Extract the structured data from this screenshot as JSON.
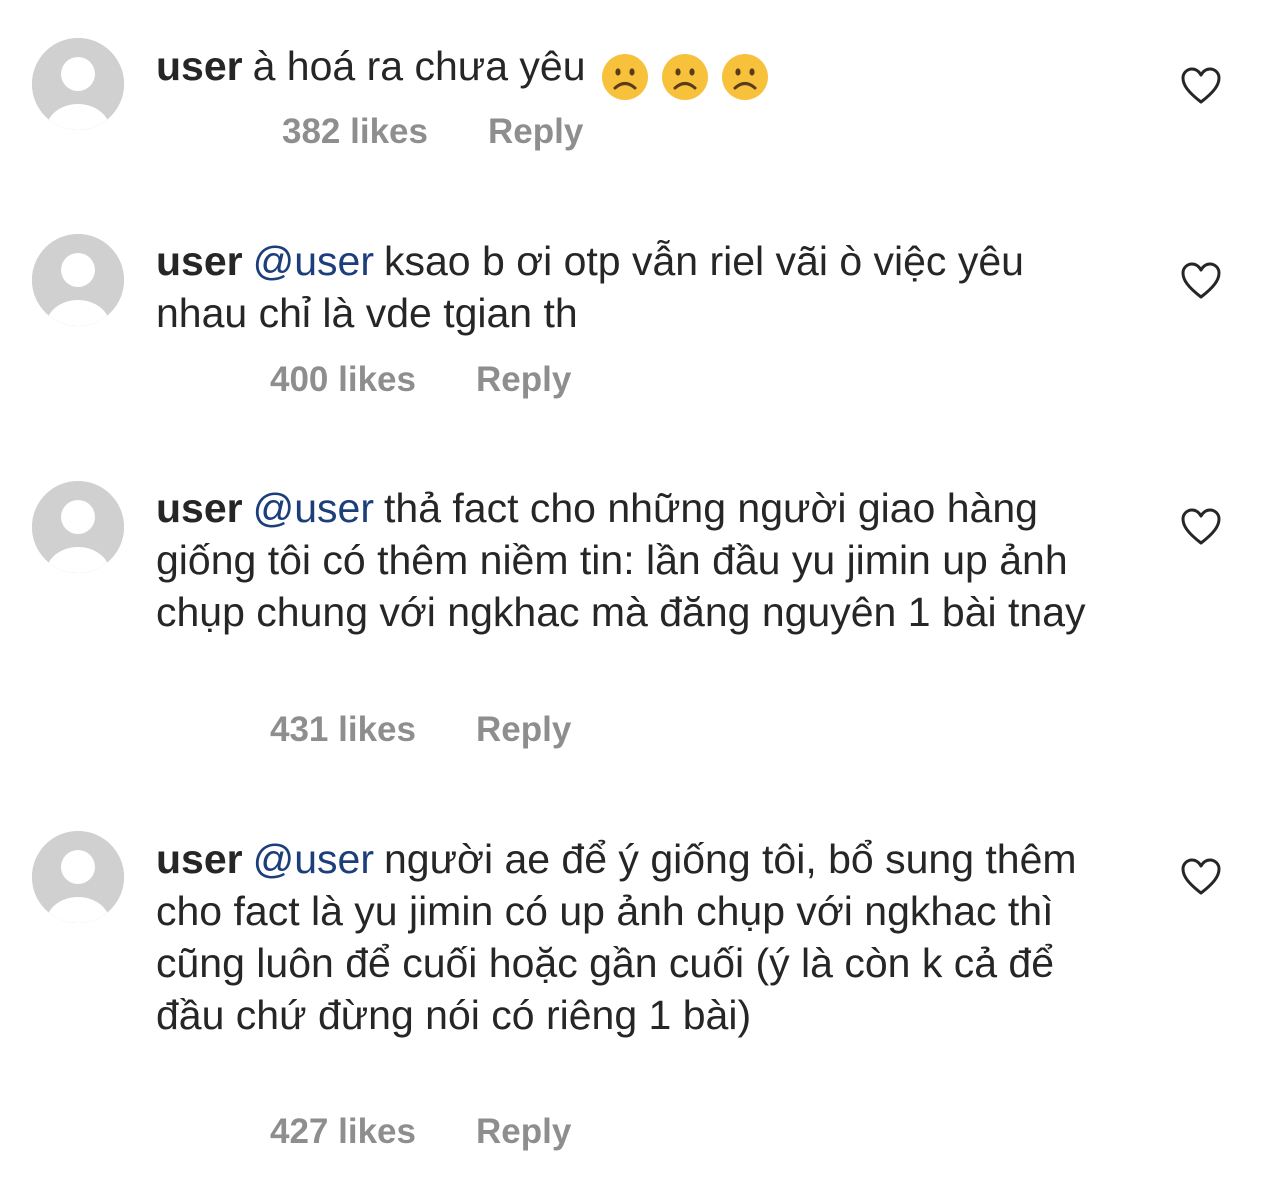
{
  "comments": [
    {
      "username": "user",
      "mention": "",
      "text": "à hoá ra chưa yêu",
      "emojis": [
        "frowning-face-emoji",
        "frowning-face-emoji",
        "frowning-face-emoji"
      ],
      "likes": "382 likes",
      "reply": "Reply"
    },
    {
      "username": "user",
      "mention": "@user",
      "text": "ksao b ơi otp vẫn riel vãi ò việc yêu nhau chỉ là vde tgian th",
      "likes": "400 likes",
      "reply": "Reply"
    },
    {
      "username": "user",
      "mention": "@user",
      "text": "thả fact cho những người giao hàng giống tôi có thêm niềm tin: lần đầu yu jimin up ảnh chụp chung với ngkhac mà đăng nguyên 1 bài tnay",
      "likes": "431 likes",
      "reply": "Reply"
    },
    {
      "username": "user",
      "mention": "@user",
      "text": "người ae để ý giống tôi, bổ sung thêm cho fact là yu jimin có up ảnh chụp với ngkhac thì cũng luôn để cuối hoặc gần cuối (ý là còn k cả để đầu chứ đừng nói có riêng 1 bài)",
      "likes": "427 likes",
      "reply": "Reply"
    }
  ],
  "colors": {
    "text": "#262626",
    "mention": "#1c3e7a",
    "meta": "#8e8e8e",
    "avatar_bg": "#d0d0d0",
    "emoji": "#f7c13b"
  },
  "icons": {
    "like": "heart-outline-icon",
    "avatar": "default-avatar-icon"
  }
}
